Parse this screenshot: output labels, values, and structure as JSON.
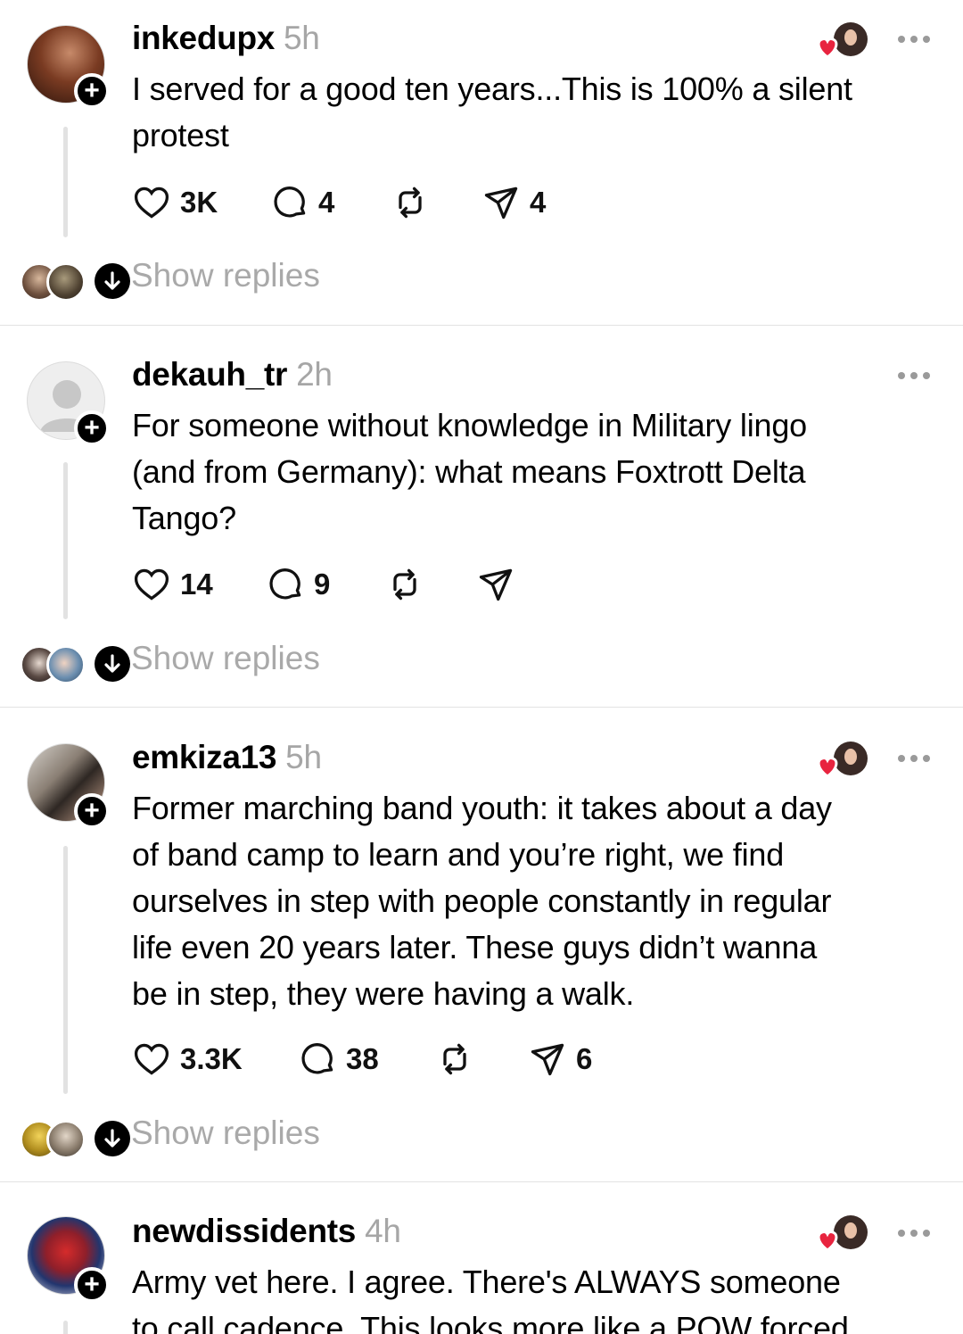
{
  "colors": {
    "like_red": "#e8243f",
    "muted": "#a6a6a6",
    "divider": "#e3e3e3"
  },
  "icons": [
    "heart-icon",
    "comment-icon",
    "repost-icon",
    "share-icon",
    "more-icon",
    "follow-plus-icon",
    "expand-down-icon"
  ],
  "posts": [
    {
      "username": "inkedupx",
      "time": "5h",
      "text": "I served for a good ten years...This is 100% a silent\nprotest",
      "likes": "3K",
      "comments": "4",
      "reposts": "",
      "shares": "4",
      "liked_by_author": true,
      "show_replies": "Show replies"
    },
    {
      "username": "dekauh_tr",
      "time": "2h",
      "text": "For someone without knowledge in Military lingo\n(and from Germany): what means Foxtrott Delta\nTango?",
      "likes": "14",
      "comments": "9",
      "reposts": "",
      "shares": "",
      "liked_by_author": false,
      "show_replies": "Show replies"
    },
    {
      "username": "emkiza13",
      "time": "5h",
      "text": "Former marching band youth: it takes about a day\nof band camp to learn and you’re right, we find\nourselves in step with people constantly in regular\nlife even 20 years later. These guys didn’t wanna\nbe in step, they were having a walk.",
      "likes": "3.3K",
      "comments": "38",
      "reposts": "",
      "shares": "6",
      "liked_by_author": true,
      "show_replies": "Show replies"
    },
    {
      "username": "newdissidents",
      "time": "4h",
      "text": "Army vet here. I agree. There's ALWAYS someone\nto call cadence. This looks more like a POW forced",
      "liked_by_author": true
    }
  ]
}
